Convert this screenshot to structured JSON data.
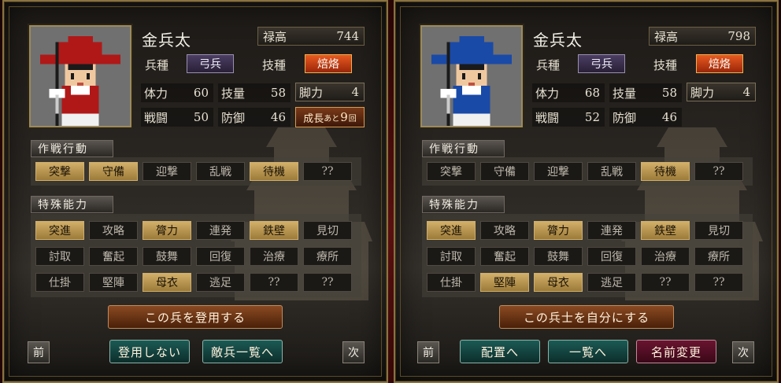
{
  "left": {
    "name": "金兵太",
    "stipend_label": "禄高",
    "stipend_value": "744",
    "class_label": "兵種",
    "class_value": "弓兵",
    "skill_label": "技種",
    "skill_value": "焙烙",
    "stats": [
      {
        "label": "体力",
        "value": "60"
      },
      {
        "label": "技量",
        "value": "58"
      },
      {
        "label": "脚力",
        "value": "4"
      },
      {
        "label": "戦闘",
        "value": "50"
      },
      {
        "label": "防御",
        "value": "46"
      }
    ],
    "growth_prefix": "成長",
    "growth_small": "あと",
    "growth_num": "9",
    "growth_suffix": "回",
    "tactics_title": "作戦行動",
    "tactics": [
      {
        "label": "突撃",
        "on": true
      },
      {
        "label": "守備",
        "on": true
      },
      {
        "label": "迎撃",
        "on": false
      },
      {
        "label": "乱戦",
        "on": false
      },
      {
        "label": "待機",
        "on": true
      },
      {
        "label": "??",
        "on": false
      }
    ],
    "abilities_title": "特殊能力",
    "abilities": [
      {
        "label": "突進",
        "on": true
      },
      {
        "label": "攻略",
        "on": false
      },
      {
        "label": "膂力",
        "on": true
      },
      {
        "label": "連発",
        "on": false
      },
      {
        "label": "鉄壁",
        "on": true
      },
      {
        "label": "見切",
        "on": false
      },
      {
        "label": "討取",
        "on": false
      },
      {
        "label": "奮起",
        "on": false
      },
      {
        "label": "鼓舞",
        "on": false
      },
      {
        "label": "回復",
        "on": false
      },
      {
        "label": "治療",
        "on": false
      },
      {
        "label": "療所",
        "on": false
      },
      {
        "label": "仕掛",
        "on": false
      },
      {
        "label": "堅陣",
        "on": false
      },
      {
        "label": "母衣",
        "on": true
      },
      {
        "label": "逃足",
        "on": false
      },
      {
        "label": "??",
        "on": false
      },
      {
        "label": "??",
        "on": false
      }
    ],
    "main_button": "この兵を登用する",
    "prev": "前",
    "next": "次",
    "bottom_buttons": [
      "登用しない",
      "敵兵一覧へ"
    ],
    "hat_color": "#b01818",
    "robe_color": "#b01818"
  },
  "right": {
    "name": "金兵太",
    "stipend_label": "禄高",
    "stipend_value": "798",
    "class_label": "兵種",
    "class_value": "弓兵",
    "skill_label": "技種",
    "skill_value": "焙烙",
    "stats": [
      {
        "label": "体力",
        "value": "68"
      },
      {
        "label": "技量",
        "value": "58"
      },
      {
        "label": "脚力",
        "value": "4"
      },
      {
        "label": "戦闘",
        "value": "52"
      },
      {
        "label": "防御",
        "value": "46"
      }
    ],
    "tactics_title": "作戦行動",
    "tactics": [
      {
        "label": "突撃",
        "on": false
      },
      {
        "label": "守備",
        "on": false
      },
      {
        "label": "迎撃",
        "on": false
      },
      {
        "label": "乱戦",
        "on": false
      },
      {
        "label": "待機",
        "on": true
      },
      {
        "label": "??",
        "on": false
      }
    ],
    "abilities_title": "特殊能力",
    "abilities": [
      {
        "label": "突進",
        "on": true
      },
      {
        "label": "攻略",
        "on": false
      },
      {
        "label": "膂力",
        "on": true
      },
      {
        "label": "連発",
        "on": false
      },
      {
        "label": "鉄壁",
        "on": true
      },
      {
        "label": "見切",
        "on": false
      },
      {
        "label": "討取",
        "on": false
      },
      {
        "label": "奮起",
        "on": false
      },
      {
        "label": "鼓舞",
        "on": false
      },
      {
        "label": "回復",
        "on": false
      },
      {
        "label": "治療",
        "on": false
      },
      {
        "label": "療所",
        "on": false
      },
      {
        "label": "仕掛",
        "on": false
      },
      {
        "label": "堅陣",
        "on": true
      },
      {
        "label": "母衣",
        "on": true
      },
      {
        "label": "逃足",
        "on": false
      },
      {
        "label": "??",
        "on": false
      },
      {
        "label": "??",
        "on": false
      }
    ],
    "main_button": "この兵士を自分にする",
    "prev": "前",
    "next": "次",
    "bottom_buttons": [
      "配置へ",
      "一覧へ",
      "名前変更"
    ],
    "hat_color": "#1a4aa8",
    "robe_color": "#1a4aa8"
  }
}
